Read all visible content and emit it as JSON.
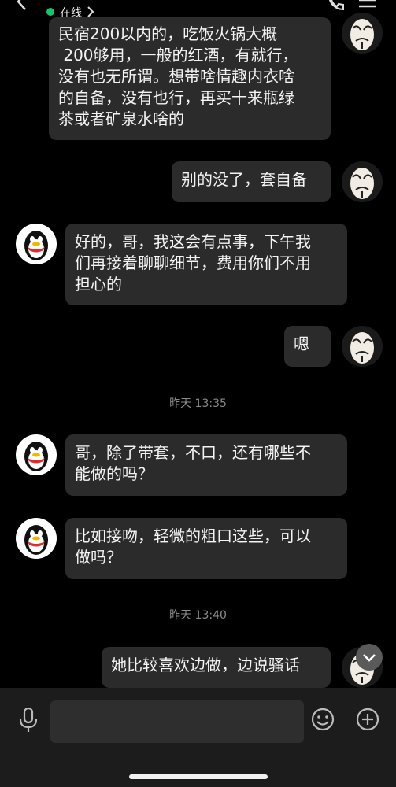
{
  "header": {
    "status": "在线"
  },
  "messages": [
    {
      "side": "right",
      "text": "民宿200以内的，吃饭火锅大概\n 200够用，一般的红酒，有就行，\n没有也无所谓。想带啥情趣内衣啥\n的自备，没有也行，再买十来瓶绿\n茶或者矿泉水啥的"
    },
    {
      "side": "right",
      "text": "别的没了，套自备"
    },
    {
      "side": "left",
      "text": "好的，哥，我这会有点事，下午我\n们再接着聊聊细节，费用你们不用\n担心的"
    },
    {
      "side": "right",
      "text": "嗯"
    },
    {
      "side": "left",
      "text": "哥，除了带套，不口，还有哪些不\n能做的吗？"
    },
    {
      "side": "left",
      "text": "比如接吻，轻微的粗口这些，可以\n做吗？"
    },
    {
      "side": "right",
      "text": "她比较喜欢边做，边说骚话"
    }
  ],
  "timestamps": [
    "昨天 13:35",
    "昨天 13:40"
  ],
  "colors": {
    "online": "#19c36b",
    "bubble": "#2b2b2b",
    "background": "#000000"
  },
  "icons": [
    "back-chevron-icon",
    "chevron-right-icon",
    "phone-icon",
    "menu-icon",
    "microphone-icon",
    "emoji-icon",
    "plus-icon",
    "scroll-down-icon"
  ]
}
